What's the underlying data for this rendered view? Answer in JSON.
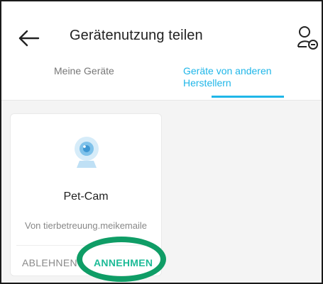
{
  "header": {
    "title": "Gerätenutzung teilen",
    "back_icon": "arrow-left-icon",
    "user_icon": "user-remove-icon"
  },
  "tabs": [
    {
      "label": "Meine Geräte",
      "active": false
    },
    {
      "label": "Geräte von anderen Herstellern",
      "active": true
    }
  ],
  "card": {
    "device_icon": "camera-icon",
    "device_name": "Pet-Cam",
    "from_text": "Von tierbetreuung.meikemaile",
    "decline_label": "ABLEHNEN",
    "accept_label": "ANNEHMEN"
  },
  "colors": {
    "accent": "#1fb6e8",
    "accept": "#1dbb97",
    "highlight": "#0f9d66"
  }
}
